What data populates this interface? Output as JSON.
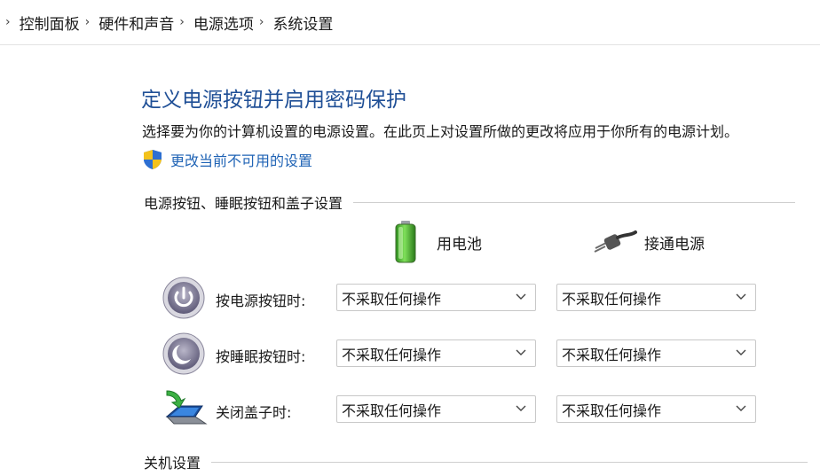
{
  "breadcrumb": {
    "items": [
      "控制面板",
      "硬件和声音",
      "电源选项",
      "系统设置"
    ]
  },
  "page": {
    "title": "定义电源按钮并启用密码保护",
    "description": "选择要为你的计算机设置的电源设置。在此页上对设置所做的更改将应用于你所有的电源计划。",
    "change_link": "更改当前不可用的设置"
  },
  "section_power": {
    "title": "电源按钮、睡眠按钮和盖子设置",
    "col_battery": "用电池",
    "col_plugged": "接通电源",
    "rows": [
      {
        "label": "按电源按钮时:",
        "battery": "不采取任何操作",
        "plugged": "不采取任何操作"
      },
      {
        "label": "按睡眠按钮时:",
        "battery": "不采取任何操作",
        "plugged": "不采取任何操作"
      },
      {
        "label": "关闭盖子时:",
        "battery": "不采取任何操作",
        "plugged": "不采取任何操作"
      }
    ]
  },
  "section_shutdown": {
    "title": "关机设置"
  },
  "icons": {
    "shield": "uac-shield-icon",
    "battery": "battery-icon",
    "plug": "power-plug-icon",
    "power_button": "power-button-icon",
    "sleep_button": "sleep-button-icon",
    "lid": "laptop-lid-icon"
  }
}
